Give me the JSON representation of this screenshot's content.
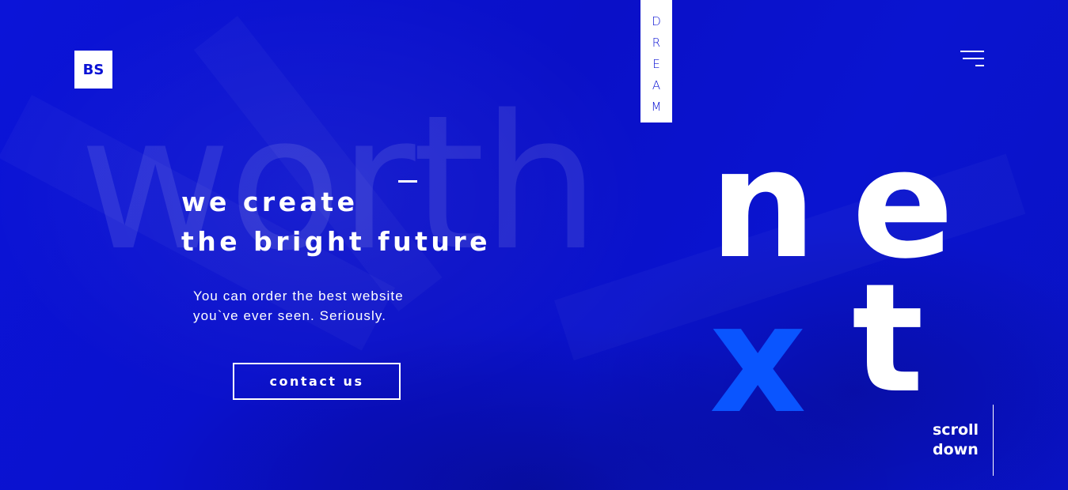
{
  "brand": {
    "logo_text": "BS"
  },
  "dream_tag": {
    "letters": [
      "D",
      "R",
      "E",
      "A",
      "M"
    ]
  },
  "menu": {
    "icon": "hamburger-menu-icon"
  },
  "hero": {
    "background_word": "worth",
    "headline_line1": "we create",
    "headline_line2": "the bright future",
    "subtext_line1": "You can order the best website",
    "subtext_line2": "you`ve ever seen. Seriously.",
    "cta_label": "contact us"
  },
  "next_word": {
    "letters": [
      "n",
      "e",
      "x",
      "t"
    ],
    "accent_letter_index": 2
  },
  "scroll": {
    "line1": "scroll",
    "line2": "down"
  },
  "colors": {
    "background": "#0a12d4",
    "accent": "#0a55ff",
    "foreground": "#ffffff"
  }
}
